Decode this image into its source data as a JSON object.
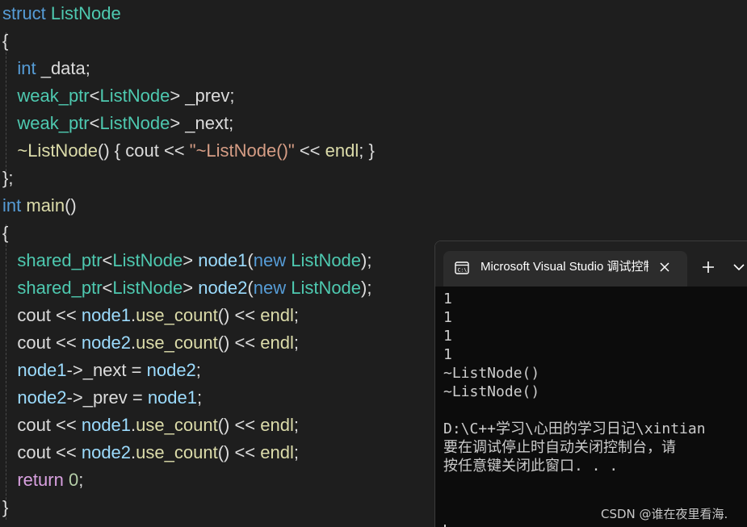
{
  "editor": {
    "lines": [
      {
        "tokens": [
          {
            "t": "struct ",
            "c": "kw"
          },
          {
            "t": "ListNode",
            "c": "type"
          }
        ]
      },
      {
        "tokens": [
          {
            "t": "{",
            "c": "plain"
          }
        ]
      },
      {
        "tokens": [
          {
            "t": "   ",
            "c": "plain"
          },
          {
            "t": "int",
            "c": "kw"
          },
          {
            "t": " _data;",
            "c": "plain"
          }
        ]
      },
      {
        "tokens": [
          {
            "t": "   ",
            "c": "plain"
          },
          {
            "t": "weak_ptr",
            "c": "type"
          },
          {
            "t": "<",
            "c": "plain"
          },
          {
            "t": "ListNode",
            "c": "type"
          },
          {
            "t": "> _prev;",
            "c": "plain"
          }
        ]
      },
      {
        "tokens": [
          {
            "t": "   ",
            "c": "plain"
          },
          {
            "t": "weak_ptr",
            "c": "type"
          },
          {
            "t": "<",
            "c": "plain"
          },
          {
            "t": "ListNode",
            "c": "type"
          },
          {
            "t": "> _next;",
            "c": "plain"
          }
        ]
      },
      {
        "tokens": [
          {
            "t": "   ",
            "c": "plain"
          },
          {
            "t": "~ListNode",
            "c": "fn"
          },
          {
            "t": "() { cout << ",
            "c": "plain"
          },
          {
            "t": "\"~ListNode()\"",
            "c": "str"
          },
          {
            "t": " << ",
            "c": "plain"
          },
          {
            "t": "endl",
            "c": "fn"
          },
          {
            "t": "; }",
            "c": "plain"
          }
        ]
      },
      {
        "tokens": [
          {
            "t": "};",
            "c": "plain"
          }
        ]
      },
      {
        "tokens": [
          {
            "t": "int",
            "c": "kw"
          },
          {
            "t": " ",
            "c": "plain"
          },
          {
            "t": "main",
            "c": "fn"
          },
          {
            "t": "()",
            "c": "plain"
          }
        ]
      },
      {
        "tokens": [
          {
            "t": "{",
            "c": "plain"
          }
        ]
      },
      {
        "tokens": [
          {
            "t": "   ",
            "c": "plain"
          },
          {
            "t": "shared_ptr",
            "c": "type"
          },
          {
            "t": "<",
            "c": "plain"
          },
          {
            "t": "ListNode",
            "c": "type"
          },
          {
            "t": "> ",
            "c": "plain"
          },
          {
            "t": "node1",
            "c": "var"
          },
          {
            "t": "(",
            "c": "plain"
          },
          {
            "t": "new",
            "c": "kw"
          },
          {
            "t": " ",
            "c": "plain"
          },
          {
            "t": "ListNode",
            "c": "type"
          },
          {
            "t": ");",
            "c": "plain"
          }
        ]
      },
      {
        "tokens": [
          {
            "t": "   ",
            "c": "plain"
          },
          {
            "t": "shared_ptr",
            "c": "type"
          },
          {
            "t": "<",
            "c": "plain"
          },
          {
            "t": "ListNode",
            "c": "type"
          },
          {
            "t": "> ",
            "c": "plain"
          },
          {
            "t": "node2",
            "c": "var"
          },
          {
            "t": "(",
            "c": "plain"
          },
          {
            "t": "new",
            "c": "kw"
          },
          {
            "t": " ",
            "c": "plain"
          },
          {
            "t": "ListNode",
            "c": "type"
          },
          {
            "t": ");",
            "c": "plain"
          }
        ]
      },
      {
        "tokens": [
          {
            "t": "   cout << ",
            "c": "plain"
          },
          {
            "t": "node1",
            "c": "var"
          },
          {
            "t": ".",
            "c": "plain"
          },
          {
            "t": "use_count",
            "c": "fn"
          },
          {
            "t": "() << ",
            "c": "plain"
          },
          {
            "t": "endl",
            "c": "fn"
          },
          {
            "t": ";",
            "c": "plain"
          }
        ]
      },
      {
        "tokens": [
          {
            "t": "   cout << ",
            "c": "plain"
          },
          {
            "t": "node2",
            "c": "var"
          },
          {
            "t": ".",
            "c": "plain"
          },
          {
            "t": "use_count",
            "c": "fn"
          },
          {
            "t": "() << ",
            "c": "plain"
          },
          {
            "t": "endl",
            "c": "fn"
          },
          {
            "t": ";",
            "c": "plain"
          }
        ]
      },
      {
        "tokens": [
          {
            "t": "   ",
            "c": "plain"
          },
          {
            "t": "node1",
            "c": "var"
          },
          {
            "t": "->_next = ",
            "c": "plain"
          },
          {
            "t": "node2",
            "c": "var"
          },
          {
            "t": ";",
            "c": "plain"
          }
        ]
      },
      {
        "tokens": [
          {
            "t": "   ",
            "c": "plain"
          },
          {
            "t": "node2",
            "c": "var"
          },
          {
            "t": "->_prev = ",
            "c": "plain"
          },
          {
            "t": "node1",
            "c": "var"
          },
          {
            "t": ";",
            "c": "plain"
          }
        ]
      },
      {
        "tokens": [
          {
            "t": "   cout << ",
            "c": "plain"
          },
          {
            "t": "node1",
            "c": "var"
          },
          {
            "t": ".",
            "c": "plain"
          },
          {
            "t": "use_count",
            "c": "fn"
          },
          {
            "t": "() << ",
            "c": "plain"
          },
          {
            "t": "endl",
            "c": "fn"
          },
          {
            "t": ";",
            "c": "plain"
          }
        ]
      },
      {
        "tokens": [
          {
            "t": "   cout << ",
            "c": "plain"
          },
          {
            "t": "node2",
            "c": "var"
          },
          {
            "t": ".",
            "c": "plain"
          },
          {
            "t": "use_count",
            "c": "fn"
          },
          {
            "t": "() << ",
            "c": "plain"
          },
          {
            "t": "endl",
            "c": "fn"
          },
          {
            "t": ";",
            "c": "plain"
          }
        ]
      },
      {
        "tokens": [
          {
            "t": "   ",
            "c": "plain"
          },
          {
            "t": "return",
            "c": "ctl"
          },
          {
            "t": " ",
            "c": "plain"
          },
          {
            "t": "0",
            "c": "num"
          },
          {
            "t": ";",
            "c": "plain"
          }
        ]
      },
      {
        "tokens": [
          {
            "t": "}",
            "c": "plain"
          }
        ]
      }
    ]
  },
  "console": {
    "tab_title": "Microsoft Visual Studio 调试控制台",
    "tab_icon": "terminal-icon",
    "close_icon": "close-icon",
    "new_tab_label": "+",
    "dropdown_icon": "chevron-down-icon",
    "output_lines": [
      "1",
      "1",
      "1",
      "1",
      "~ListNode()",
      "~ListNode()",
      "",
      "D:\\C++学习\\心田的学习日记\\xintian",
      "要在调试停止时自动关闭控制台，请",
      "按任意键关闭此窗口. . ."
    ]
  },
  "watermark": {
    "text": "CSDN @谁在夜里看海."
  },
  "colors": {
    "editor_bg": "#1e1e1e",
    "keyword": "#569cd6",
    "type": "#4ec9b0",
    "variable": "#9cdcfe",
    "function": "#dcdcaa",
    "string": "#d69d85",
    "number": "#b5cea8",
    "control": "#d8a0df",
    "console_bg": "#0c0c0c",
    "console_text": "#cccccc"
  }
}
